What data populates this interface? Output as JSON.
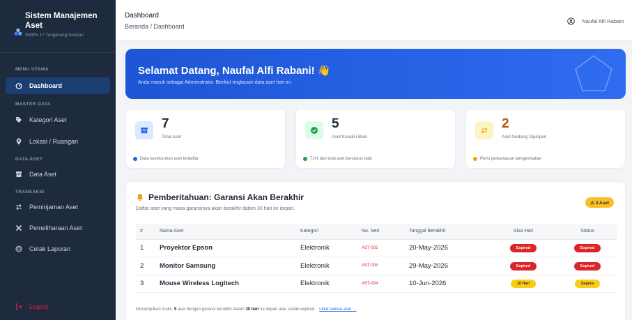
{
  "sidebar": {
    "app_title_line1": "Sistem Manajemen",
    "app_title_line2": "Aset",
    "school": "SMPN 17 Tangerang Selatan",
    "section_main": "MENU UTAMA",
    "dashboard": "Dashboard",
    "section_master": "MASTER DATA",
    "kategori": "Kategori Aset",
    "lokasi": "Lokasi / Ruangan",
    "section_data": "DATA ASET",
    "data_aset": "Data Aset",
    "section_transaksi": "TRANSAKSI",
    "peminjaman": "Peminjaman Aset",
    "pemeliharaan": "Pemeliharaan Aset",
    "cetak": "Cetak Laporan",
    "logout": "Logout"
  },
  "topbar": {
    "title": "Dashboard",
    "breadcrumb": "Beranda / Dashboard",
    "user": "Naufal Alfi Rabani"
  },
  "hero": {
    "title": "Selamat Datang, Naufal Alfi Rabani! 👋",
    "subtitle": "Anda masuk sebagai Administrator. Berikut ringkasan data aset hari ini."
  },
  "stats": [
    {
      "value": "7",
      "label": "Total Aset",
      "note": "Data keseluruhan aset terdaftar",
      "accent": "#2563eb"
    },
    {
      "value": "5",
      "label": "Aset Kondisi Baik",
      "note": "71% dari total aset berstatus baik",
      "accent": "#16a34a"
    },
    {
      "value": "2",
      "label": "Aset Sedang Dipinjam",
      "note": "Perlu pemantauan pengembalian",
      "accent": "#f59e0b"
    }
  ],
  "warranty": {
    "title": "Pemberitahuan: Garansi Akan Berakhir",
    "subtitle": "Daftar aset yang masa garansinya akan berakhir dalam 30 hari ke depan.",
    "count_badge": "⚠ 3 Aset",
    "columns": [
      "#",
      "Nama Aset",
      "Kategori",
      "No. Seri",
      "Tanggal Berakhir",
      "Sisa Hari",
      "Status"
    ],
    "rows": [
      {
        "no": "1",
        "name": "Proyektor Epson",
        "category": "Elektronik",
        "serial": "AST-002",
        "end": "20-May-2026",
        "remaining": "Expired",
        "status": "Expired"
      },
      {
        "no": "2",
        "name": "Monitor Samsung",
        "category": "Elektronik",
        "serial": "AST-005",
        "end": "29-May-2026",
        "remaining": "Expired",
        "status": "Expired"
      },
      {
        "no": "3",
        "name": "Mouse Wireless Logitech",
        "category": "Elektronik",
        "serial": "AST-004",
        "end": "10-Jun-2026",
        "remaining": "10 Hari",
        "status": "Segera"
      }
    ],
    "footer_pre": "Menampilkan maks.",
    "footer_count": "5",
    "footer_mid": "aset dengan garansi berakhir dalam",
    "footer_days": "30 hari",
    "footer_post": "ke depan atau sudah expired.",
    "footer_link": "Lihat semua aset →"
  }
}
